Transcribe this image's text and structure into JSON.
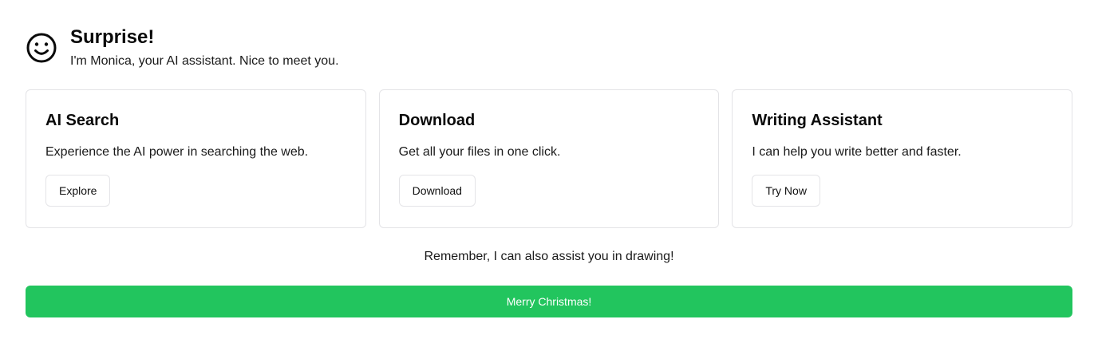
{
  "header": {
    "icon": "smiley-icon",
    "title": "Surprise!",
    "subtitle": "I'm Monica, your AI assistant. Nice to meet you."
  },
  "cards": [
    {
      "title": "AI Search",
      "description": "Experience the AI power in searching the web.",
      "button_label": "Explore"
    },
    {
      "title": "Download",
      "description": "Get all your files in one click.",
      "button_label": "Download"
    },
    {
      "title": "Writing Assistant",
      "description": "I can help you write better and faster.",
      "button_label": "Try Now"
    }
  ],
  "reminder": "Remember, I can also assist you in drawing!",
  "cta": {
    "label": "Merry Christmas!",
    "color": "#22c55e"
  }
}
